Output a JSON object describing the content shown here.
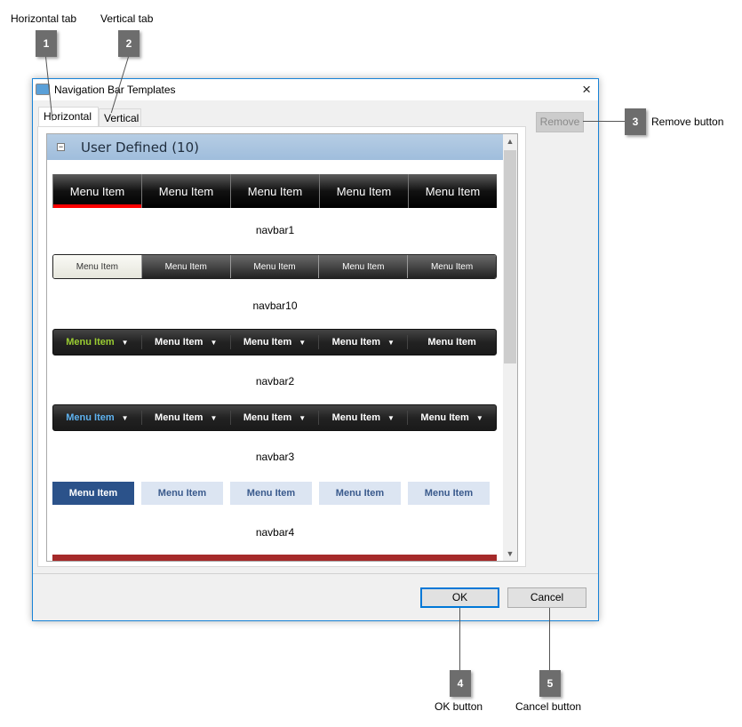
{
  "callouts": [
    {
      "num": "1",
      "label": "Horizontal tab"
    },
    {
      "num": "2",
      "label": "Vertical tab"
    },
    {
      "num": "3",
      "label": "Remove button"
    },
    {
      "num": "4",
      "label": "OK button"
    },
    {
      "num": "5",
      "label": "Cancel button"
    }
  ],
  "window": {
    "title": "Navigation Bar Templates",
    "close_icon": "×"
  },
  "tabs": [
    {
      "label": "Horizontal",
      "active": true
    },
    {
      "label": "Vertical",
      "active": false
    }
  ],
  "group": {
    "label": "User Defined (10)",
    "toggle": "−"
  },
  "navbars": [
    {
      "name": "navbar1",
      "style": "n1",
      "items": [
        "Menu Item",
        "Menu Item",
        "Menu Item",
        "Menu Item",
        "Menu Item"
      ],
      "selected": 0,
      "selected_color": "#ff0000"
    },
    {
      "name": "navbar10",
      "style": "n10",
      "items": [
        "Menu Item",
        "Menu Item",
        "Menu Item",
        "Menu Item",
        "Menu Item"
      ],
      "selected": 0
    },
    {
      "name": "navbar2",
      "style": "n2",
      "items": [
        "Menu Item",
        "Menu Item",
        "Menu Item",
        "Menu Item",
        "Menu Item"
      ],
      "dropdown": [
        true,
        true,
        true,
        true,
        false
      ],
      "selected": 0,
      "selected_color": "#9acd32"
    },
    {
      "name": "navbar3",
      "style": "n2",
      "items": [
        "Menu Item",
        "Menu Item",
        "Menu Item",
        "Menu Item",
        "Menu Item"
      ],
      "dropdown": [
        true,
        true,
        true,
        true,
        true
      ],
      "selected": 0,
      "selected_color": "#5fb3f0"
    },
    {
      "name": "navbar4",
      "style": "n4",
      "items": [
        "Menu Item",
        "Menu Item",
        "Menu Item",
        "Menu Item",
        "Menu Item"
      ],
      "selected": 0,
      "selected_color": "#2b528a"
    }
  ],
  "buttons": {
    "remove": "Remove",
    "ok": "OK",
    "cancel": "Cancel"
  }
}
